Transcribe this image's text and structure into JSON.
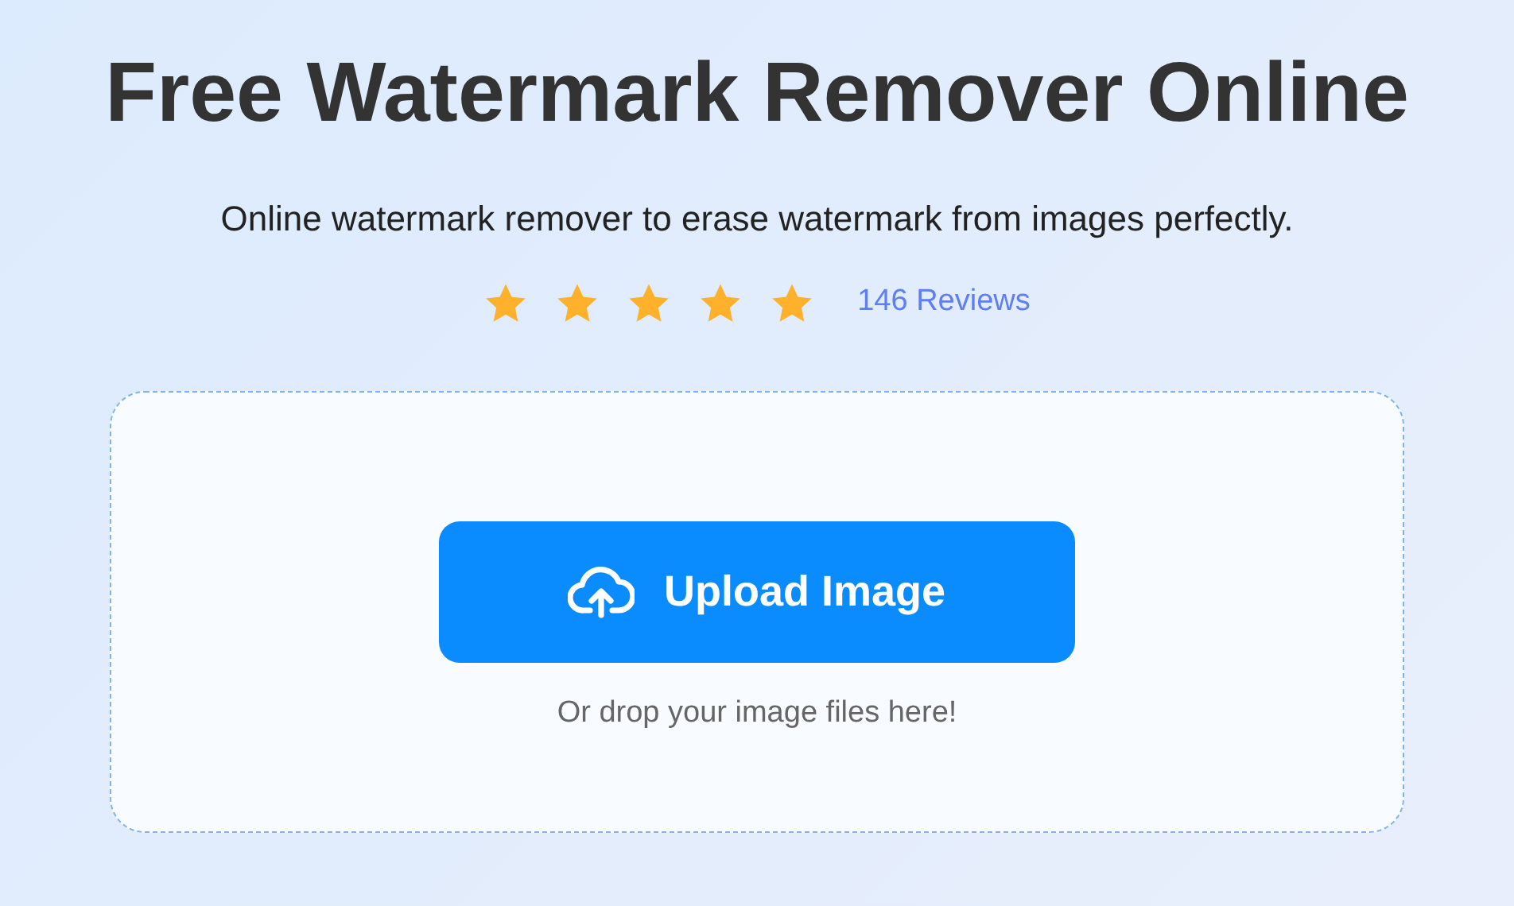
{
  "title": "Free Watermark Remover Online",
  "subtitle": "Online watermark remover to erase watermark from images perfectly.",
  "rating": {
    "stars": 5,
    "reviews": "146 Reviews"
  },
  "upload": {
    "button": "Upload Image",
    "hint": "Or drop your image files here!"
  }
}
